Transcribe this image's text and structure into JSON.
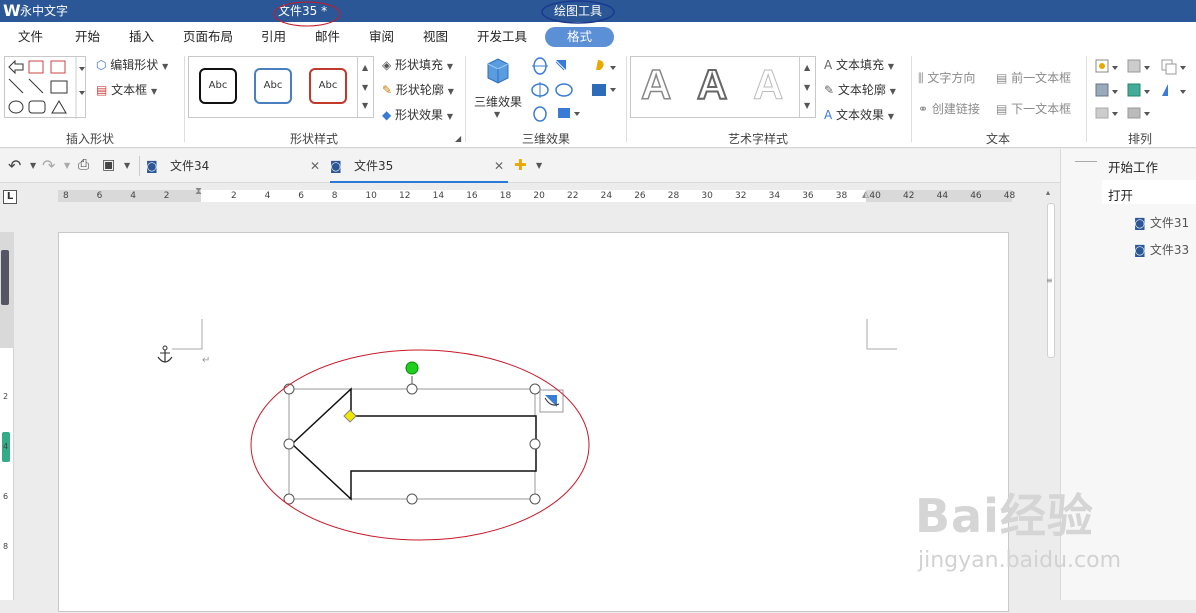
{
  "titlebar": {
    "app_name": "永中文字",
    "doc_title": "文件35 *",
    "tool_context": "绘图工具"
  },
  "menu": {
    "items": [
      "文件",
      "开始",
      "插入",
      "页面布局",
      "引用",
      "邮件",
      "审阅",
      "视图",
      "开发工具"
    ],
    "active": "格式"
  },
  "ribbon": {
    "groups": {
      "insert_shape": "插入形状",
      "shape_style": "形状样式",
      "effect3d": "三维效果",
      "art_style": "艺术字样式",
      "text": "文本",
      "arrange": "排列"
    },
    "edit_shape": "编辑形状",
    "text_box": "文本框",
    "style_sample": "Abc",
    "shape_fill": "形状填充",
    "shape_outline": "形状轮廓",
    "shape_effect": "形状效果",
    "effect3d_btn": "三维效果",
    "text_fill": "文本填充",
    "text_outline": "文本轮廓",
    "text_effect": "文本效果",
    "text_direction": "文字方向",
    "create_link": "创建链接",
    "prev_textbox": "前一文本框",
    "next_textbox": "下一文本框",
    "wordart_letter": "A"
  },
  "tabs": [
    {
      "label": "文件34",
      "active": false
    },
    {
      "label": "文件35",
      "active": true
    }
  ],
  "ruler": {
    "ticks": [
      "8",
      "6",
      "4",
      "2",
      "2",
      "4",
      "6",
      "8",
      "10",
      "12",
      "14",
      "16",
      "18",
      "20",
      "22",
      "24",
      "26",
      "28",
      "30",
      "32",
      "34",
      "36",
      "38",
      "40",
      "42",
      "44",
      "46",
      "48"
    ]
  },
  "vruler": {
    "ticks": [
      "2",
      "4",
      "6",
      "8"
    ]
  },
  "sidepanel": {
    "title": "开始工作",
    "open": "打开",
    "files": [
      "文件31",
      "文件33"
    ]
  },
  "watermark": {
    "brand": "Bai经验",
    "url": "jingyan.baidu.com"
  },
  "colors": {
    "titlebar": "#2b5797",
    "active_menu": "#5b8fd6",
    "annotation": "#c8192a",
    "rotate_handle": "#1ecf1e",
    "adjust_handle": "#f2e600"
  }
}
